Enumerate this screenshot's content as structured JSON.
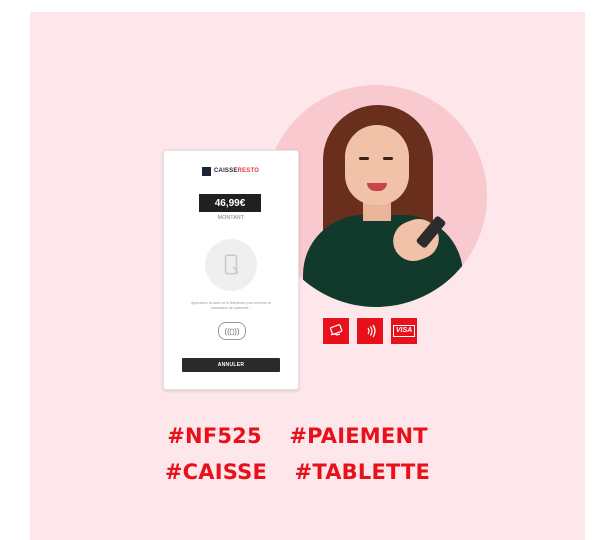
{
  "terminal": {
    "brand_prefix": "CAISSE",
    "brand_suffix": "RESTO",
    "amount": "46,99€",
    "amount_label": "MONTANT",
    "instruction": "Approchez la carte ou le téléphone pour terminer la transaction de paiement...",
    "cancel_label": "ANNULER"
  },
  "badges": {
    "card_icon": "card-hand-icon",
    "contactless_icon": "contactless-icon",
    "visa_label": "VISA",
    "color": "#e8101b"
  },
  "hashtags": {
    "row1": [
      "#NF525",
      "#PAIEMENT"
    ],
    "row2": [
      "#CAISSE",
      "#TABLETTE"
    ]
  },
  "colors": {
    "background": "#fde7ea",
    "accent": "#e8101b",
    "circle": "#f8c9cf"
  }
}
